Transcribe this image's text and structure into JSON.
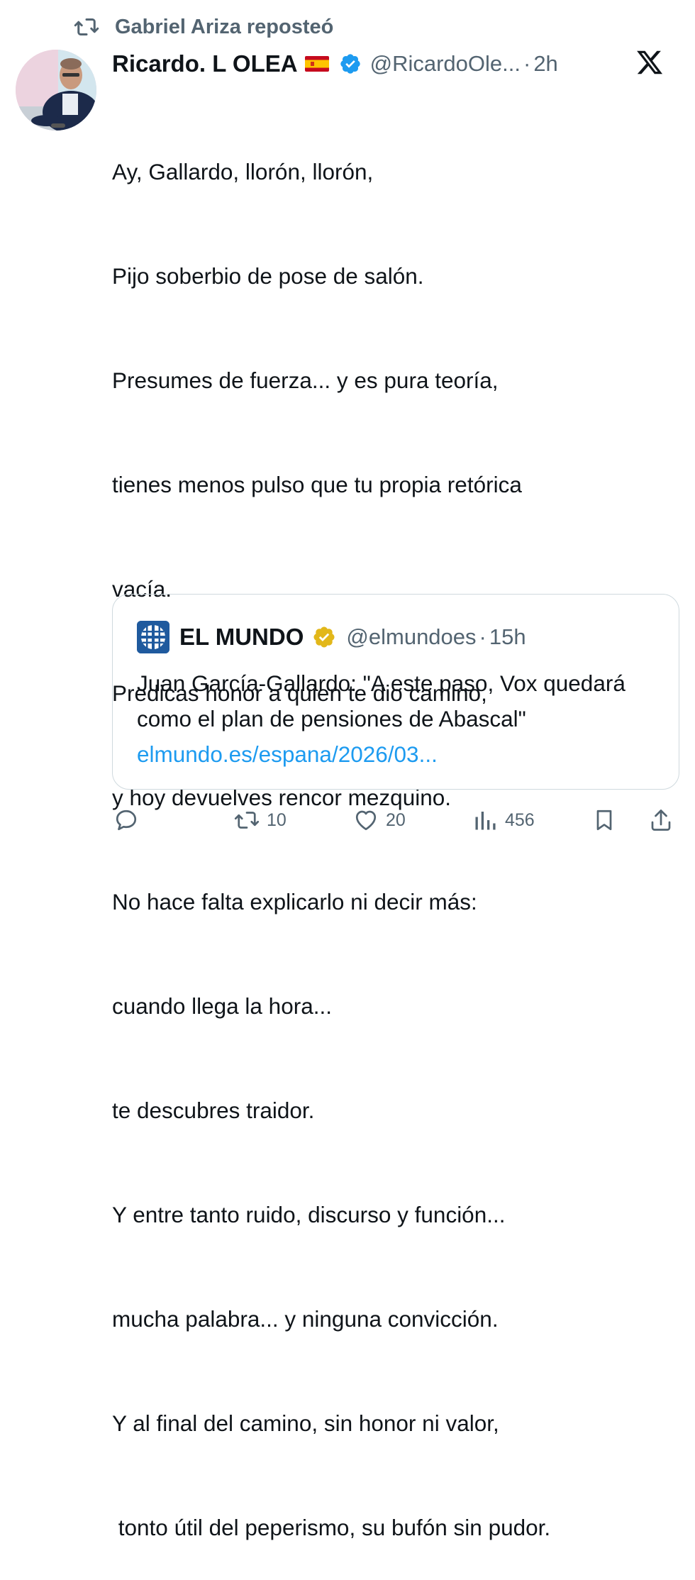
{
  "repost": {
    "text": "Gabriel Ariza reposteó"
  },
  "tweet": {
    "author_name": "Ricardo. L OLEA",
    "handle": "@RicardoOle...",
    "separator": "·",
    "time": "2h",
    "lines": [
      "Ay, Gallardo, llorón, llorón,",
      "Pijo soberbio de pose de salón.",
      "Presumes de fuerza... y es pura teoría,",
      "tienes menos pulso que tu propia retórica",
      "vacía.",
      "Predicas honor a quien te dio camino,",
      "y hoy devuelves rencor mezquino.",
      "No hace falta explicarlo ni decir más:",
      "cuando llega la hora...",
      "te descubres traidor.",
      "Y entre tanto ruido, discurso y función...",
      "mucha palabra... y ninguna convicción.",
      "Y al final del camino, sin honor ni valor,",
      " tonto útil del peperismo, su bufón sin pudor."
    ]
  },
  "quote": {
    "author_name": "EL MUNDO",
    "handle": "@elmundoes",
    "separator": "·",
    "time": "15h",
    "text": "Juan García-Gallardo: \"A este paso, Vox quedará como el plan de pensiones de Abascal\" ",
    "link": "elmundo.es/espana/2026/03..."
  },
  "actions": {
    "reply_count": "",
    "repost_count": "10",
    "like_count": "20",
    "views_count": "456"
  },
  "icons": {
    "repost": "repost-icon",
    "verified": "verified-badge-icon",
    "gold_verified": "gold-verified-badge-icon",
    "x_logo": "x-logo-icon",
    "flag": "spain-flag-icon",
    "reply": "reply-icon",
    "like": "heart-icon",
    "views": "views-icon",
    "bookmark": "bookmark-icon",
    "share": "share-icon"
  },
  "colors": {
    "text": "#0f1419",
    "secondary": "#536471",
    "link": "#1d9bf0",
    "verified_blue": "#1d9bf0",
    "verified_gold": "#e2b719",
    "border": "#cfd9de"
  }
}
